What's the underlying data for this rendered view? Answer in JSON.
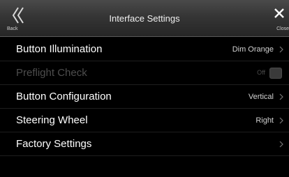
{
  "header": {
    "title": "Interface Settings",
    "back_label": "Back",
    "close_label": "Close",
    "back_icon": "double-chevron-left-icon",
    "close_icon": "x-icon"
  },
  "settings": [
    {
      "label": "Button Illumination",
      "value": "Dim Orange",
      "enabled": true
    },
    {
      "label": "Preflight Check",
      "value": "Off",
      "enabled": false,
      "toggle": true
    },
    {
      "label": "Button Configuration",
      "value": "Vertical",
      "enabled": true
    },
    {
      "label": "Steering Wheel",
      "value": "Right",
      "enabled": true
    },
    {
      "label": "Factory Settings",
      "value": "",
      "enabled": true
    }
  ],
  "colors": {
    "background": "#000000",
    "header": "#353535",
    "disabled_text": "#4d4d4d"
  }
}
